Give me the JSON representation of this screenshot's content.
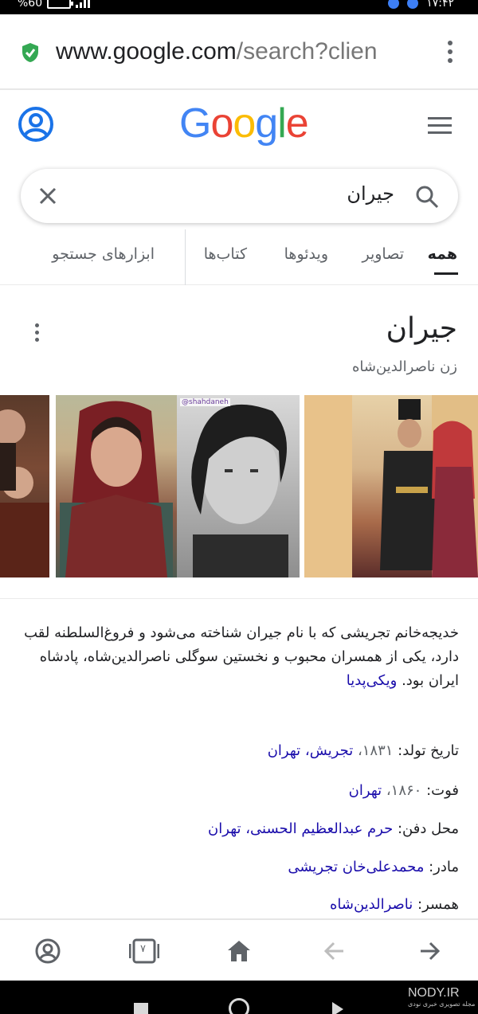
{
  "status_bar": {
    "battery": "%60",
    "time": "۱۷:۴۲"
  },
  "browser": {
    "url_domain": "www.google.com",
    "url_path": "/search?clien",
    "secure_icon": "shield-check-icon",
    "menu_icon": "more-vert-icon"
  },
  "google": {
    "logo": [
      "G",
      "o",
      "o",
      "g",
      "l",
      "e"
    ],
    "logo_colors": [
      "#4285F4",
      "#EA4335",
      "#FBBC05",
      "#4285F4",
      "#34A853",
      "#EA4335"
    ],
    "account_icon": "account-circle-icon",
    "menu_icon": "hamburger-icon"
  },
  "search": {
    "query": "جیران",
    "clear_icon": "close-icon",
    "search_icon": "search-icon"
  },
  "tabs": {
    "all": "همه",
    "images": "تصاویر",
    "videos": "ویدئوها",
    "books": "کتاب‌ها",
    "tools": "ابزارهای جستجو"
  },
  "knowledge_panel": {
    "title": "جیران",
    "subtitle": "زن ناصرالدین‌شاه",
    "description": "خدیجه‌خانم تجریشی که با نام جیران شناخته می‌شود و فروغ‌السلطنه لقب دارد، یکی از همسران محبوب و نخستین سوگلی ناصرالدین‌شاه، پادشاه ایران بود.",
    "source_link": "ویکی‌پدیا",
    "facts": [
      {
        "label": "تاریخ تولد:",
        "text": "۱۸۳۱، ",
        "link": "تجریش، تهران"
      },
      {
        "label": "فوت:",
        "text": "۱۸۶۰، ",
        "link": "تهران"
      },
      {
        "label": "محل دفن:",
        "text": "",
        "link": "حرم عبدالعظیم الحسنی، تهران"
      },
      {
        "label": "مادر:",
        "text": "",
        "link": "محمدعلی‌خان تجریشی"
      },
      {
        "label": "همسر:",
        "text": "",
        "link": "ناصرالدین‌شاه"
      }
    ],
    "image_watermark": "@shahdaneh"
  },
  "toolbar": {
    "tab_count": "۷",
    "icons": [
      "account-icon",
      "tab-switcher-icon",
      "home-icon",
      "back-arrow-icon",
      "forward-arrow-icon"
    ]
  },
  "watermark": {
    "site": "NODY.IR",
    "tagline": "مجله تصویری خبری نودی"
  },
  "colors": {
    "link": "#1a0dab",
    "secure": "#34A853",
    "accent_blue": "#1A73E8"
  }
}
